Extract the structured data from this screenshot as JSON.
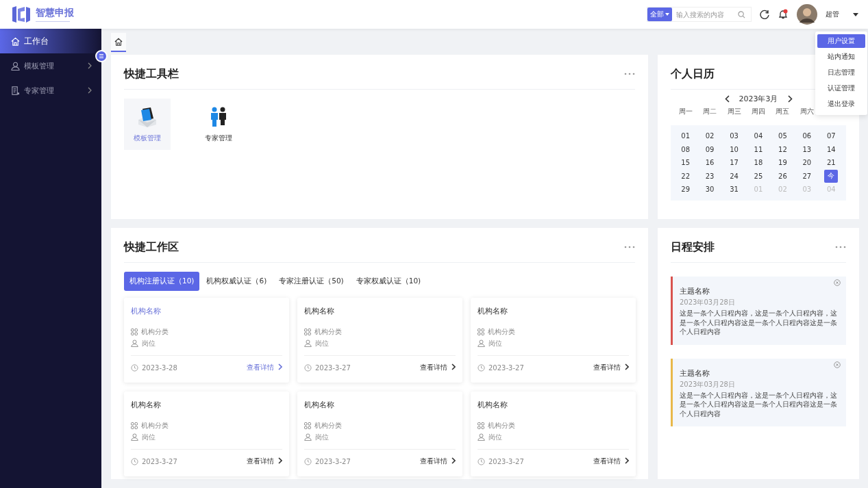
{
  "header": {
    "logo_text": "智慧申报",
    "search": {
      "scope": "全部",
      "placeholder": "输入搜索的内容"
    },
    "has_unread": true,
    "user_name": "超管"
  },
  "user_menu": {
    "items": [
      {
        "label": "用户设置",
        "selected": true
      },
      {
        "label": "站内通知",
        "selected": false
      },
      {
        "label": "日志管理",
        "selected": false
      },
      {
        "label": "认证管理",
        "selected": false
      },
      {
        "label": "退出登录",
        "selected": false
      }
    ]
  },
  "sidebar": {
    "items": [
      {
        "label": "工作台",
        "kind": "home",
        "selected": true,
        "has_children": false
      },
      {
        "label": "模板管理",
        "kind": "user",
        "selected": false,
        "has_children": true
      },
      {
        "label": "专家管理",
        "kind": "document",
        "selected": false,
        "has_children": true
      }
    ]
  },
  "tool_panel": {
    "title": "快捷工具栏",
    "items": [
      {
        "label": "模板管理",
        "kind": "templates",
        "selected": true
      },
      {
        "label": "专家管理",
        "kind": "experts",
        "selected": false
      }
    ]
  },
  "calendar": {
    "title": "个人日历",
    "month": "2023年3月",
    "weekdays": [
      "周一",
      "周二",
      "周三",
      "周四",
      "周五",
      "周六"
    ],
    "days": [
      {
        "label": "01",
        "current": true,
        "selected": false
      },
      {
        "label": "02",
        "current": true,
        "selected": false
      },
      {
        "label": "03",
        "current": true,
        "selected": false
      },
      {
        "label": "04",
        "current": true,
        "selected": false
      },
      {
        "label": "05",
        "current": true,
        "selected": false
      },
      {
        "label": "06",
        "current": true,
        "selected": false
      },
      {
        "label": "07",
        "current": true,
        "selected": false
      },
      {
        "label": "08",
        "current": true,
        "selected": false
      },
      {
        "label": "09",
        "current": true,
        "selected": false
      },
      {
        "label": "10",
        "current": true,
        "selected": false
      },
      {
        "label": "11",
        "current": true,
        "selected": false
      },
      {
        "label": "12",
        "current": true,
        "selected": false
      },
      {
        "label": "13",
        "current": true,
        "selected": false
      },
      {
        "label": "14",
        "current": true,
        "selected": false
      },
      {
        "label": "15",
        "current": true,
        "selected": false
      },
      {
        "label": "16",
        "current": true,
        "selected": false
      },
      {
        "label": "17",
        "current": true,
        "selected": false
      },
      {
        "label": "18",
        "current": true,
        "selected": false
      },
      {
        "label": "19",
        "current": true,
        "selected": false
      },
      {
        "label": "20",
        "current": true,
        "selected": false
      },
      {
        "label": "21",
        "current": true,
        "selected": false
      },
      {
        "label": "22",
        "current": true,
        "selected": false
      },
      {
        "label": "23",
        "current": true,
        "selected": false
      },
      {
        "label": "24",
        "current": true,
        "selected": false
      },
      {
        "label": "25",
        "current": true,
        "selected": false
      },
      {
        "label": "26",
        "current": true,
        "selected": false
      },
      {
        "label": "27",
        "current": true,
        "selected": false
      },
      {
        "label": "今",
        "current": true,
        "selected": true
      },
      {
        "label": "29",
        "current": true,
        "selected": false
      },
      {
        "label": "30",
        "current": true,
        "selected": false
      },
      {
        "label": "31",
        "current": true,
        "selected": false
      },
      {
        "label": "01",
        "current": false,
        "selected": false
      },
      {
        "label": "02",
        "current": false,
        "selected": false
      },
      {
        "label": "03",
        "current": false,
        "selected": false
      },
      {
        "label": "04",
        "current": false,
        "selected": false
      }
    ]
  },
  "workspace": {
    "title": "快捷工作区",
    "tabs": [
      {
        "label": "机构注册认证（10)",
        "selected": true
      },
      {
        "label": "机构权威认证（6)",
        "selected": false
      },
      {
        "label": "专家注册认证（50)",
        "selected": false
      },
      {
        "label": "专家权威认证（10)",
        "selected": false
      }
    ],
    "cards": [
      {
        "name": "机构名称",
        "category": "机构分类",
        "position": "岗位",
        "date": "2023-3-28",
        "link": "查看详情",
        "selected": true
      },
      {
        "name": "机构名称",
        "category": "机构分类",
        "position": "岗位",
        "date": "2023-3-27",
        "link": "查看详情",
        "selected": false
      },
      {
        "name": "机构名称",
        "category": "机构分类",
        "position": "岗位",
        "date": "2023-3-27",
        "link": "查看详情",
        "selected": false
      },
      {
        "name": "机构名称",
        "category": "机构分类",
        "position": "岗位",
        "date": "2023-3-27",
        "link": "查看详情",
        "selected": false
      },
      {
        "name": "机构名称",
        "category": "机构分类",
        "position": "岗位",
        "date": "2023-3-27",
        "link": "查看详情",
        "selected": false
      },
      {
        "name": "机构名称",
        "category": "机构分类",
        "position": "岗位",
        "date": "2023-3-27",
        "link": "查看详情",
        "selected": false
      }
    ]
  },
  "schedule": {
    "title": "日程安排",
    "items": [
      {
        "title": "主题名称",
        "date": "2023年03月28日",
        "content": "这是一条个人日程内容，这是一条个人日程内容，这是一条个人日程内容这是一条个人日程内容这是一条个人日程内容",
        "color": "#d9534f"
      },
      {
        "title": "主题名称",
        "date": "2023年03月28日",
        "content": "这是一条个人日程内容，这是一条个人日程内容，这是一条个人日程内容这是一条个人日程内容这是一条个人日程内容",
        "color": "#e8b84a"
      }
    ]
  }
}
